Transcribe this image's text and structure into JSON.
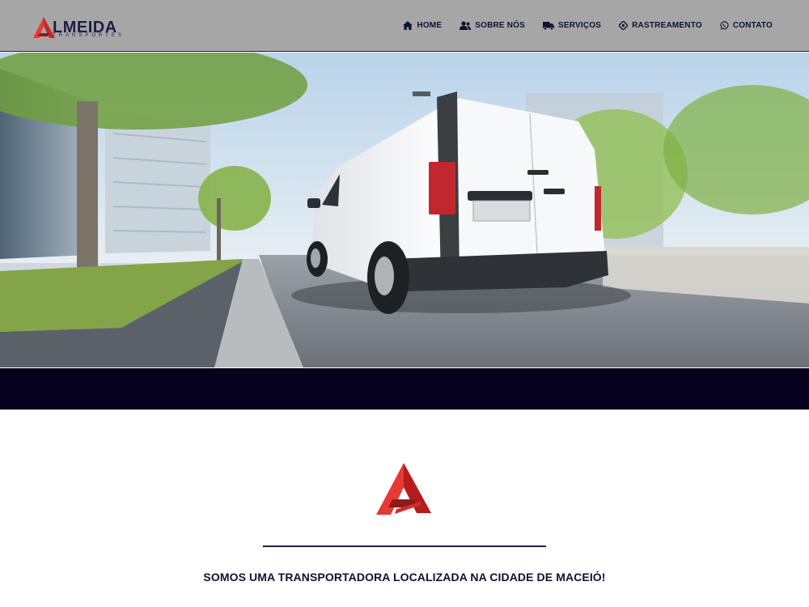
{
  "header": {
    "logo": {
      "word": "LMEIDA",
      "subtitle": "TRANSPORTES",
      "icon": "almeida-a-logo-icon"
    },
    "nav": [
      {
        "label": "HOME",
        "icon": "home-icon"
      },
      {
        "label": "SOBRE NÓS",
        "icon": "users-icon"
      },
      {
        "label": "SERVIÇOS",
        "icon": "truck-icon"
      },
      {
        "label": "RASTREAMENTO",
        "icon": "location-crosshair-icon"
      },
      {
        "label": "CONTATO",
        "icon": "whatsapp-icon"
      }
    ]
  },
  "hero": {
    "image": "white-delivery-van-photo"
  },
  "content": {
    "tagline": "SOMOS UMA TRANSPORTADORA LOCALIZADA NA CIDADE DE MACEIÓ!"
  },
  "colors": {
    "header_bg": "#a6a6a6",
    "navy": "#06021e",
    "brand_red": "#c62828",
    "text_dark": "#0e1230"
  }
}
